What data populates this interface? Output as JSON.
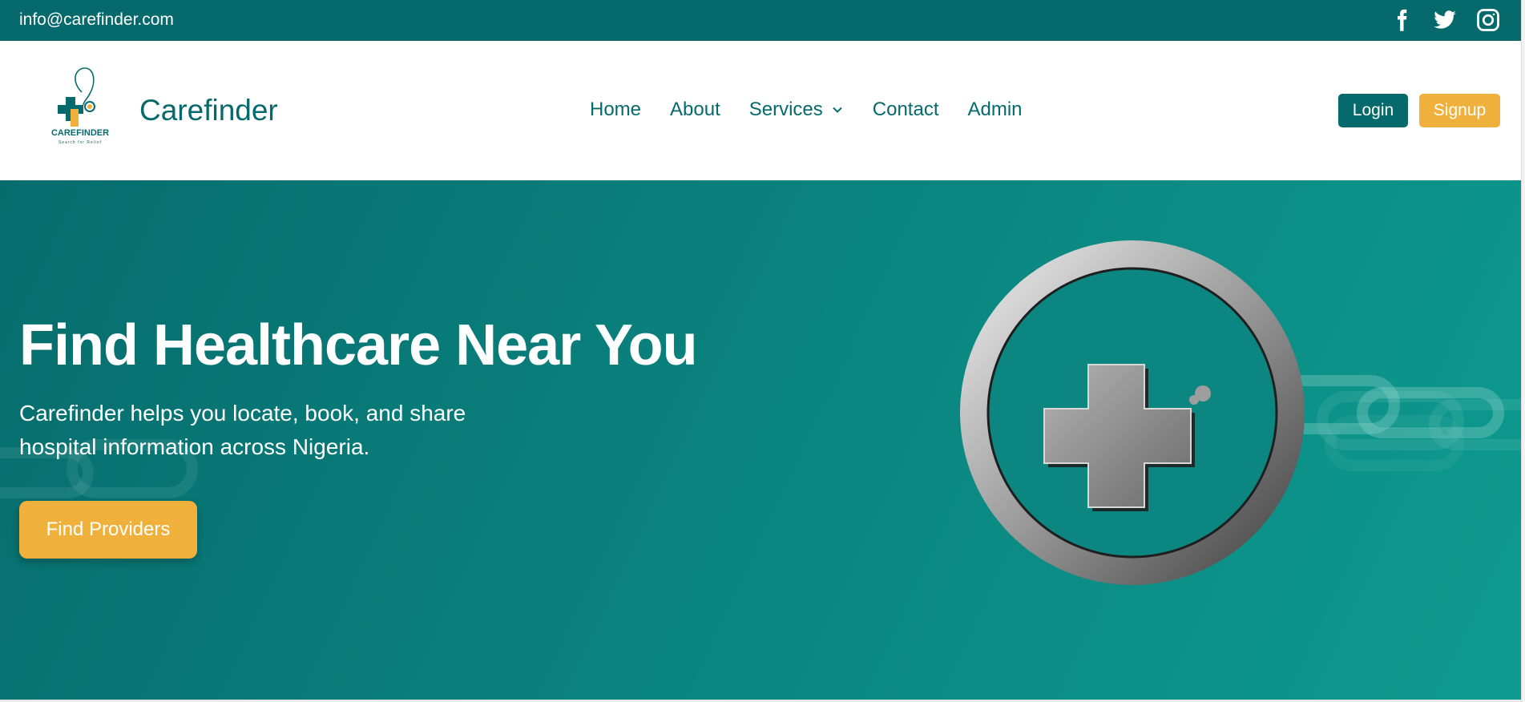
{
  "topbar": {
    "email": "info@carefinder.com",
    "socials": [
      {
        "icon": "facebook-icon"
      },
      {
        "icon": "twitter-icon"
      },
      {
        "icon": "instagram-icon"
      }
    ]
  },
  "nav": {
    "logo_text": "CAREFINDER",
    "logo_tagline": "Search for Relief",
    "brand": "Carefinder",
    "menu": [
      {
        "label": "Home"
      },
      {
        "label": "About"
      },
      {
        "label": "Services",
        "has_dropdown": true
      },
      {
        "label": "Contact"
      },
      {
        "label": "Admin"
      }
    ],
    "login_label": "Login",
    "signup_label": "Signup"
  },
  "hero": {
    "title": "Find Healthcare Near You",
    "description": "Carefinder helps you locate, book, and share hospital information across Nigeria.",
    "cta_label": "Find Providers"
  },
  "colors": {
    "primary": "#066a6c",
    "accent": "#efb13b",
    "hero_gradient_end": "#0e9b8f",
    "white": "#ffffff"
  }
}
